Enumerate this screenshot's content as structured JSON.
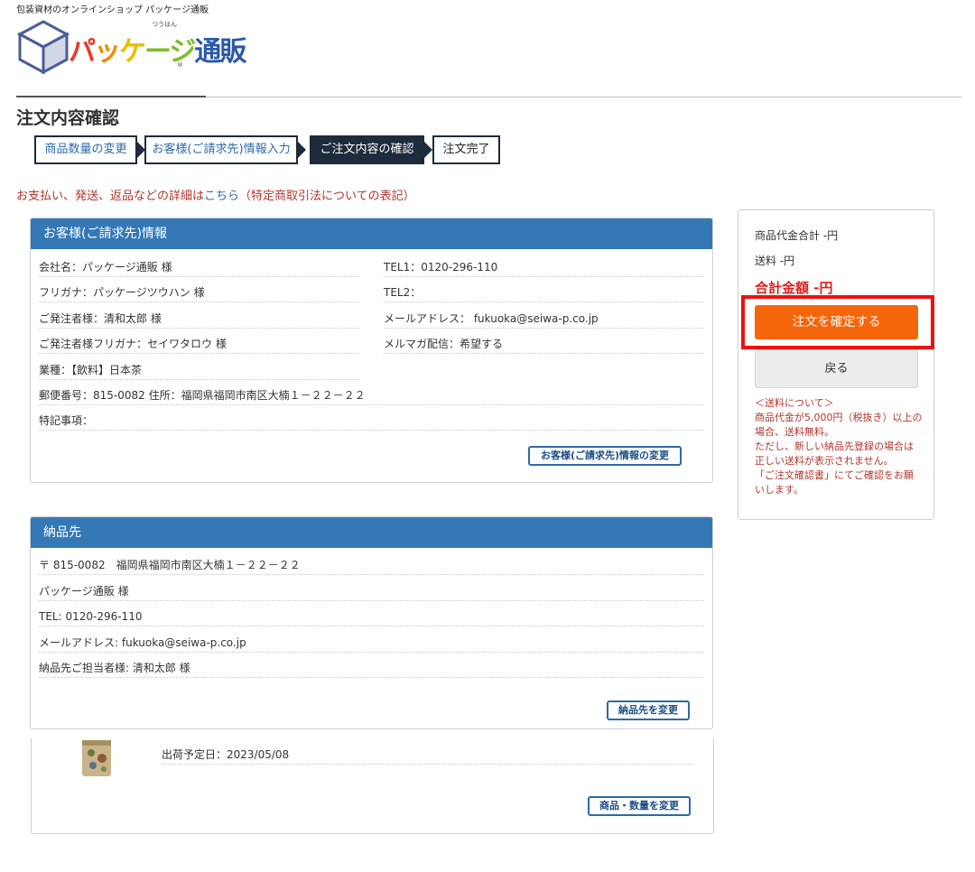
{
  "header": {
    "tagline": "包装資材のオンラインショップ パッケージ通販",
    "logo_text": "パッケージ通販",
    "logo_ruby": "つうはん",
    "logo_reg": "®"
  },
  "page_title": "注文内容確認",
  "steps": [
    {
      "label": "商品数量の変更",
      "state": "link"
    },
    {
      "label": "お客様(ご請求先)情報入力",
      "state": "link"
    },
    {
      "label": "ご注文内容の確認",
      "state": "active"
    },
    {
      "label": "注文完了",
      "state": "pending"
    }
  ],
  "notice": {
    "before": "お支払い、発送、返品などの詳細は",
    "link": "こちら",
    "after": "（特定商取引法についての表記）"
  },
  "customer": {
    "heading": "お客様(ご請求先)情報",
    "company": "会社名：パッケージ通販 様",
    "tel1": "TEL1：0120-296-110",
    "furigana": "フリガナ：パッケージツウハン 様",
    "tel2": "TEL2：",
    "orderer": "ご発注者様：清和太郎 様",
    "email": "メールアドレス： fukuoka@seiwa-p.co.jp",
    "orderer_kana": "ご発注者様フリガナ：セイワタロウ 様",
    "mailmag": "メルマガ配信：希望する",
    "industry": "業種：【飲料】日本茶",
    "address": "郵便番号：815-0082  住所：福岡県福岡市南区大楠１－２２－２２",
    "notes": "特記事項：",
    "change_button": "お客様(ご請求先)情報の変更"
  },
  "delivery": {
    "heading": "納品先",
    "postal_address": "〒 815-0082　福岡県福岡市南区大楠１－２２－２２",
    "name": "パッケージ通販 様",
    "tel": "TEL: 0120-296-110",
    "email": "メールアドレス: fukuoka@seiwa-p.co.jp",
    "contact": "納品先ご担当者様: 清和太郎 様",
    "change_button": "納品先を変更"
  },
  "product": {
    "ship_date": "出荷予定日：2023/05/08",
    "change_button": "商品・数量を変更"
  },
  "summary": {
    "subtotal": "商品代金合計 -円",
    "shipping": "送料 -円",
    "total": "合計金額 -円",
    "confirm_button": "注文を確定する",
    "back_button": "戻る",
    "note_lines": [
      "＜送料について＞",
      "商品代金が5,000円（税抜き）以上の",
      "場合、送料無料。",
      "ただし、新しい納品先登録の場合は",
      "正しい送料が表示されません。",
      "「ご注文確認書」にてご確認をお願",
      "いします。"
    ]
  },
  "colors": {
    "panel_header": "#3478b6",
    "step_dark": "#1e2b3c",
    "confirm_orange": "#f5650a",
    "highlight_red": "#ee1111",
    "total_red": "#e02020",
    "notice_red": "#b0362c"
  }
}
